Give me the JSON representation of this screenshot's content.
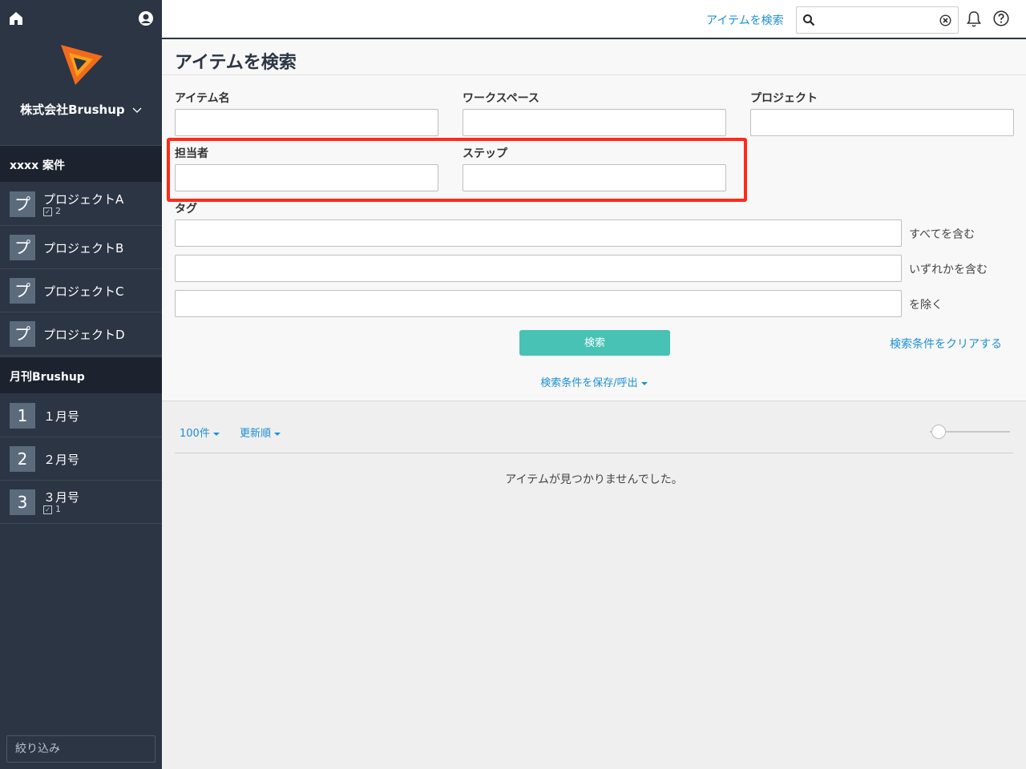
{
  "sidebar": {
    "company": "株式会社Brushup",
    "sections": [
      {
        "title": "xxxx 案件",
        "items": [
          {
            "badge": "プ",
            "label": "プロジェクトA",
            "count": "2"
          },
          {
            "badge": "プ",
            "label": "プロジェクトB"
          },
          {
            "badge": "プ",
            "label": "プロジェクトC"
          },
          {
            "badge": "プ",
            "label": "プロジェクトD"
          }
        ]
      },
      {
        "title": "月刊Brushup",
        "items": [
          {
            "badge": "1",
            "label": "１月号"
          },
          {
            "badge": "2",
            "label": "２月号"
          },
          {
            "badge": "3",
            "label": "３月号",
            "count": "1"
          }
        ]
      }
    ],
    "filter_placeholder": "絞り込み"
  },
  "header": {
    "search_link": "アイテムを検索",
    "search_value": ""
  },
  "form": {
    "title": "アイテムを検索",
    "labels": {
      "item_name": "アイテム名",
      "workspace": "ワークスペース",
      "project": "プロジェクト",
      "assignee": "担当者",
      "step": "ステップ",
      "tag": "タグ"
    },
    "tag_modes": [
      "すべてを含む",
      "いずれかを含む",
      "を除く"
    ],
    "search_button": "検索",
    "clear_link": "検索条件をクリアする",
    "save_link": "検索条件を保存/呼出"
  },
  "results": {
    "per_page": "100件",
    "sort": "更新順",
    "empty_message": "アイテムが見つかりませんでした。"
  },
  "colors": {
    "sidebar_bg": "#2b3544",
    "accent": "#1e8fd4",
    "button": "#47c2b5",
    "highlight": "#ff2a1a"
  }
}
